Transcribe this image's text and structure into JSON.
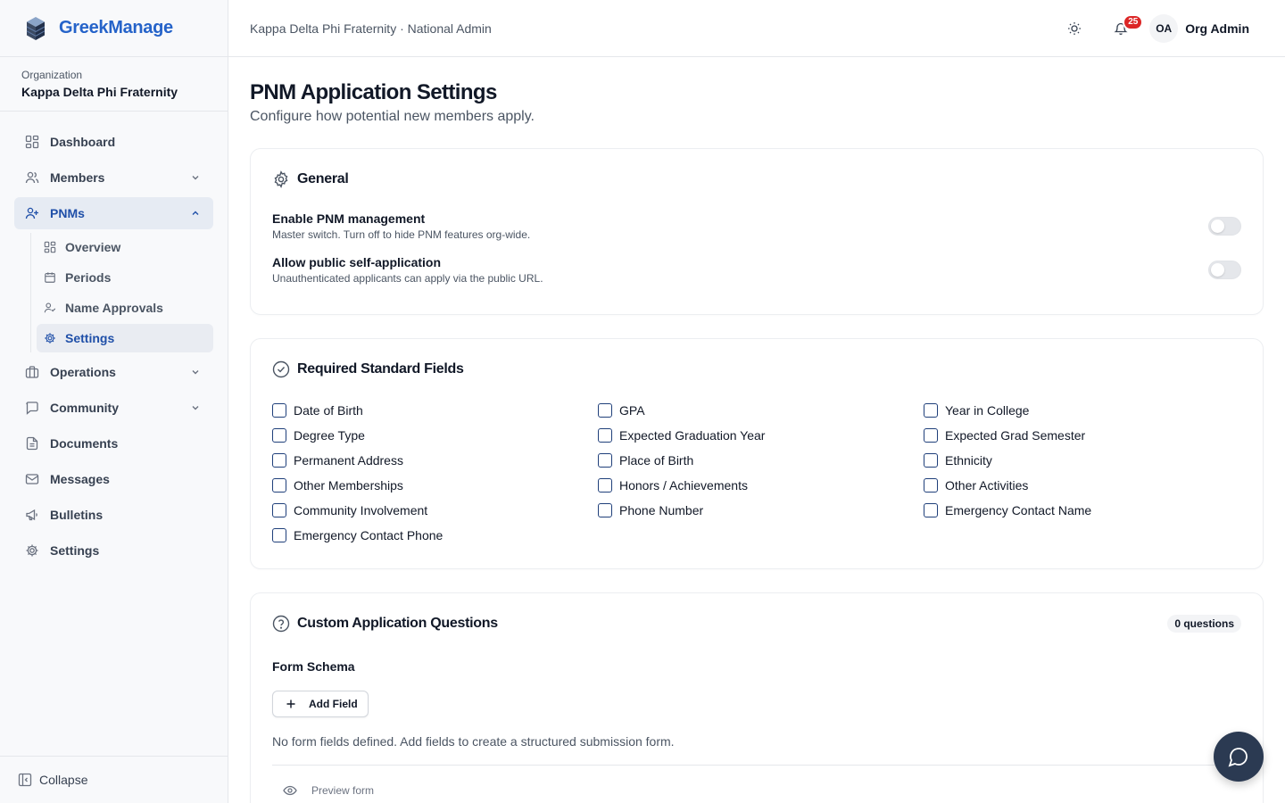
{
  "brand": {
    "name": "GreekManage"
  },
  "org": {
    "caption": "Organization",
    "name": "Kappa Delta Phi Fraternity"
  },
  "sidebar": {
    "items": [
      {
        "label": "Dashboard"
      },
      {
        "label": "Members"
      },
      {
        "label": "PNMs"
      },
      {
        "label": "Operations"
      },
      {
        "label": "Community"
      },
      {
        "label": "Documents"
      },
      {
        "label": "Messages"
      },
      {
        "label": "Bulletins"
      },
      {
        "label": "Settings"
      }
    ],
    "pnm_sub": [
      {
        "label": "Overview"
      },
      {
        "label": "Periods"
      },
      {
        "label": "Name Approvals"
      },
      {
        "label": "Settings"
      }
    ],
    "collapse_label": "Collapse"
  },
  "header": {
    "context": "Kappa Delta Phi Fraternity · National Admin",
    "notification_count": "25",
    "user_initials": "OA",
    "user_name": "Org Admin"
  },
  "page": {
    "title": "PNM Application Settings",
    "subtitle": "Configure how potential new members apply."
  },
  "general": {
    "title": "General",
    "toggles": [
      {
        "label": "Enable PNM management",
        "help": "Master switch. Turn off to hide PNM features org-wide.",
        "on": false
      },
      {
        "label": "Allow public self-application",
        "help": "Unauthenticated applicants can apply via the public URL.",
        "on": false
      }
    ]
  },
  "required_fields": {
    "title": "Required Standard Fields",
    "fields": [
      "Date of Birth",
      "GPA",
      "Year in College",
      "Degree Type",
      "Expected Graduation Year",
      "Expected Grad Semester",
      "Permanent Address",
      "Place of Birth",
      "Ethnicity",
      "Other Memberships",
      "Honors / Achievements",
      "Other Activities",
      "Community Involvement",
      "Phone Number",
      "Emergency Contact Name",
      "Emergency Contact Phone"
    ]
  },
  "custom_questions": {
    "title": "Custom Application Questions",
    "count_label": "0 questions",
    "schema_label": "Form Schema",
    "add_label": "Add Field",
    "empty_text": "No form fields defined. Add fields to create a structured submission form.",
    "preview_label": "Preview form"
  },
  "colors": {
    "accent": "#2563c9",
    "active_bg": "#e6ebf3",
    "badge": "#dc2626",
    "fab": "#2b3a52"
  }
}
